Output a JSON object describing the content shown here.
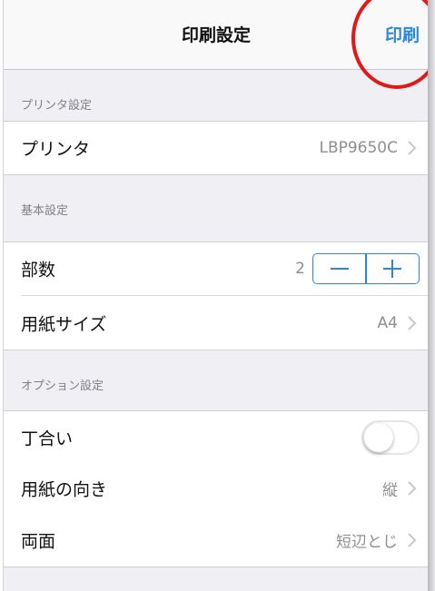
{
  "navbar": {
    "title": "印刷設定",
    "print_label": "印刷"
  },
  "sections": {
    "printer": {
      "header": "プリンタ設定",
      "printer_label": "プリンタ",
      "printer_value": "LBP9650C"
    },
    "basic": {
      "header": "基本設定",
      "copies_label": "部数",
      "copies_value": "2",
      "paper_size_label": "用紙サイズ",
      "paper_size_value": "A4"
    },
    "options": {
      "header": "オプション設定",
      "collate_label": "丁合い",
      "collate_on": false,
      "orientation_label": "用紙の向き",
      "orientation_value": "縦",
      "duplex_label": "両面",
      "duplex_value": "短辺とじ"
    }
  },
  "colors": {
    "accent": "#2b88d8",
    "highlight_circle": "#e01818",
    "background": "#efeff4",
    "secondary_text": "#8e8e93"
  },
  "icons": {
    "chevron": "chevron-right-icon",
    "minus": "minus-icon",
    "plus": "plus-icon"
  }
}
